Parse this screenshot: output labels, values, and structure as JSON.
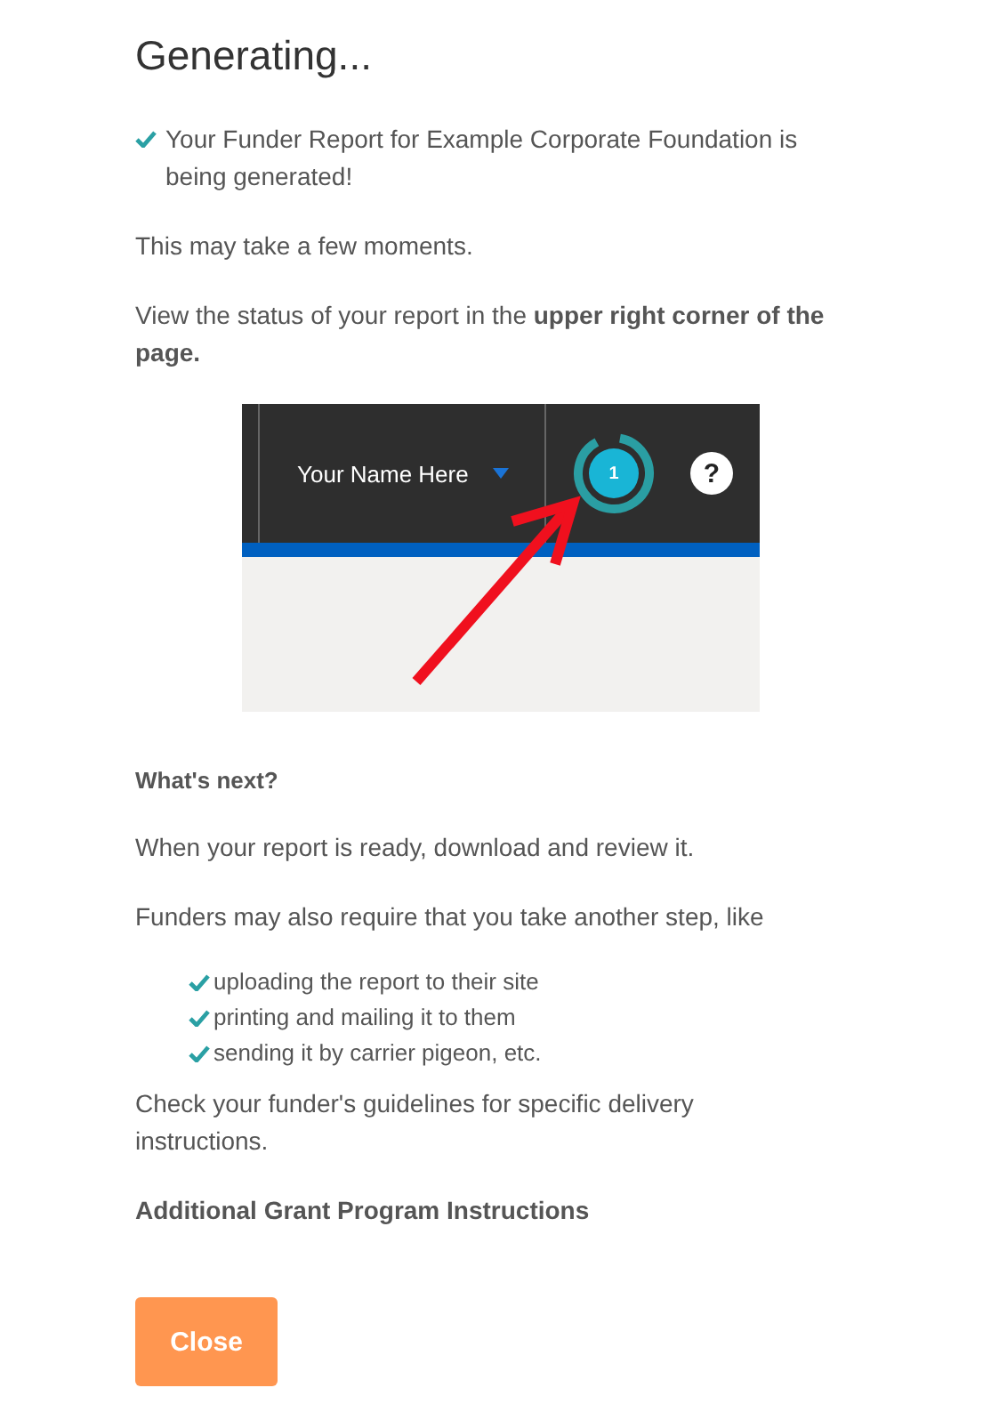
{
  "title": "Generating...",
  "success_message": "Your Funder Report for Example Corporate Foundation is being generated!",
  "note": "This may take a few moments.",
  "status_hint": "View the status of your report in the **upper right corner of the page.**",
  "illustration": {
    "user_name": "Your Name Here",
    "badge_count": "1",
    "help_icon": "?"
  },
  "whats_next": {
    "heading": "What's next?",
    "paragraphs": [
      "When your report is ready, download and review it.",
      "Funders may also require that you take another step, like"
    ],
    "steps": [
      "uploading the report to their site",
      "printing and mailing it to them",
      "sending it by carrier pigeon, etc."
    ],
    "closing": "Check your funder's guidelines for specific delivery instructions."
  },
  "instructions_heading": "Additional Grant Program Instructions",
  "close_button": "Close"
}
